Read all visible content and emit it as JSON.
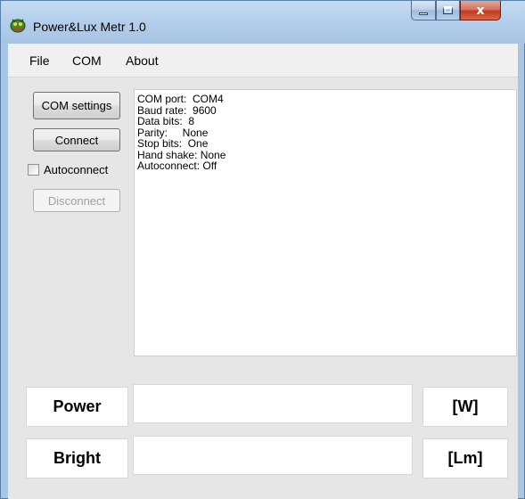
{
  "window": {
    "title": "Power&Lux Metr 1.0",
    "close_glyph": "x",
    "accent_color": "#a9c6e4"
  },
  "icons": {
    "app": "app-logo-icon",
    "minimize": "minimize-icon",
    "maximize": "maximize-icon",
    "close": "close-icon"
  },
  "menu": {
    "items": [
      {
        "label": "File"
      },
      {
        "label": "COM"
      },
      {
        "label": "About"
      }
    ]
  },
  "sidebar": {
    "com_settings_label": "COM settings",
    "connect_label": "Connect",
    "autoconnect_label": "Autoconnect",
    "autoconnect_checked": false,
    "disconnect_label": "Disconnect",
    "disconnect_enabled": false
  },
  "info": {
    "lines": [
      "COM port:  COM4",
      "Baud rate:  9600",
      "Data bits:  8",
      "Parity:     None",
      "Stop bits:  One",
      "Hand shake: None",
      "Autoconnect: Off"
    ]
  },
  "readings": {
    "power": {
      "label": "Power",
      "value": "",
      "unit": "[W]"
    },
    "bright": {
      "label": "Bright",
      "value": "",
      "unit": "[Lm]"
    }
  }
}
